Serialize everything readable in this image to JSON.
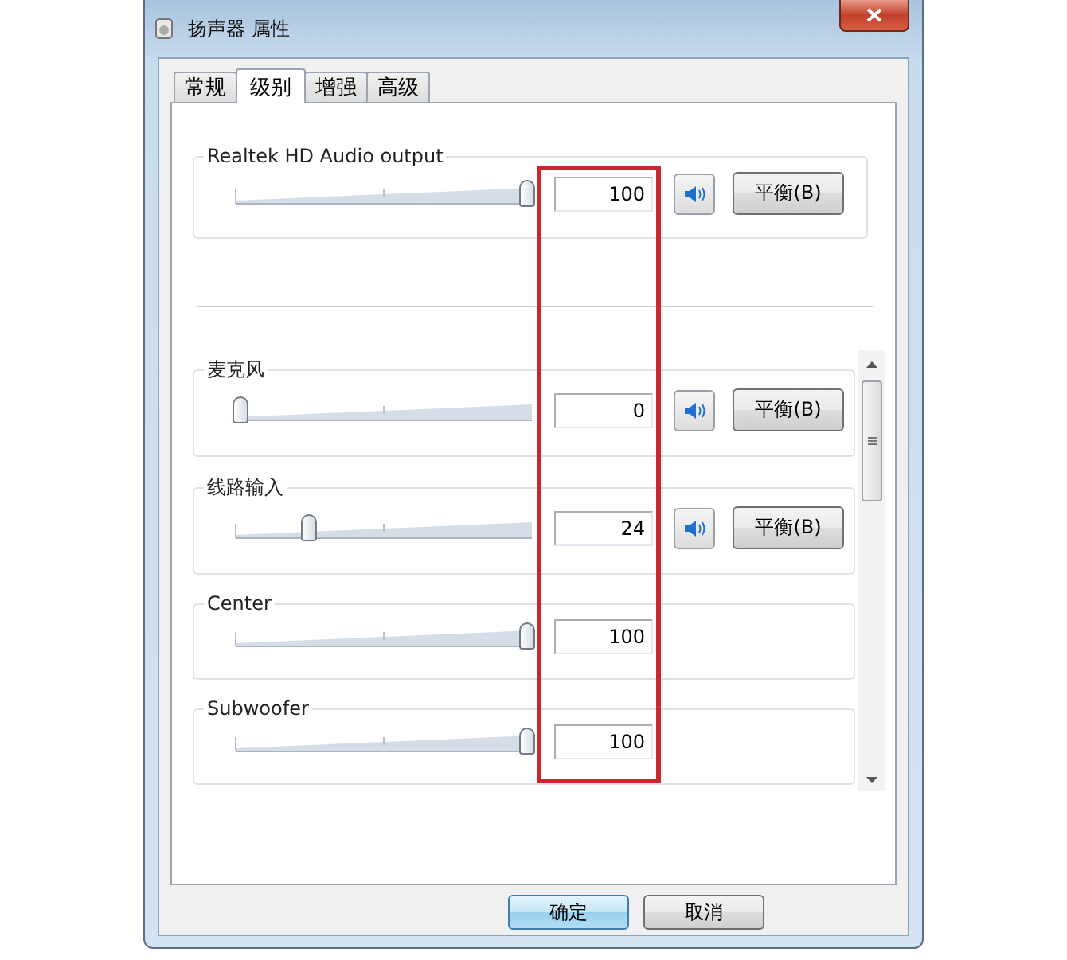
{
  "window": {
    "title": "扬声器 属性"
  },
  "tabs": [
    {
      "label": "常规",
      "selected": false
    },
    {
      "label": "级别",
      "selected": true
    },
    {
      "label": "增强",
      "selected": false
    },
    {
      "label": "高级",
      "selected": false
    }
  ],
  "master": {
    "name": "Realtek HD Audio output",
    "level": 1,
    "value": "100",
    "balance_button": "平衡(B)"
  },
  "channels": [
    {
      "name": "麦克风",
      "level": 0,
      "value": "0",
      "balance_button": "平衡(B)"
    },
    {
      "name": "线路输入",
      "level": 0.24,
      "value": "24",
      "balance_button": "平衡(B)"
    },
    {
      "name": "Center",
      "level": 1,
      "value": "100"
    },
    {
      "name": "Subwoofer",
      "level": 1,
      "value": "100"
    }
  ],
  "buttons": [
    {
      "label": "确定",
      "default": true
    },
    {
      "label": "取消",
      "default": false
    }
  ]
}
